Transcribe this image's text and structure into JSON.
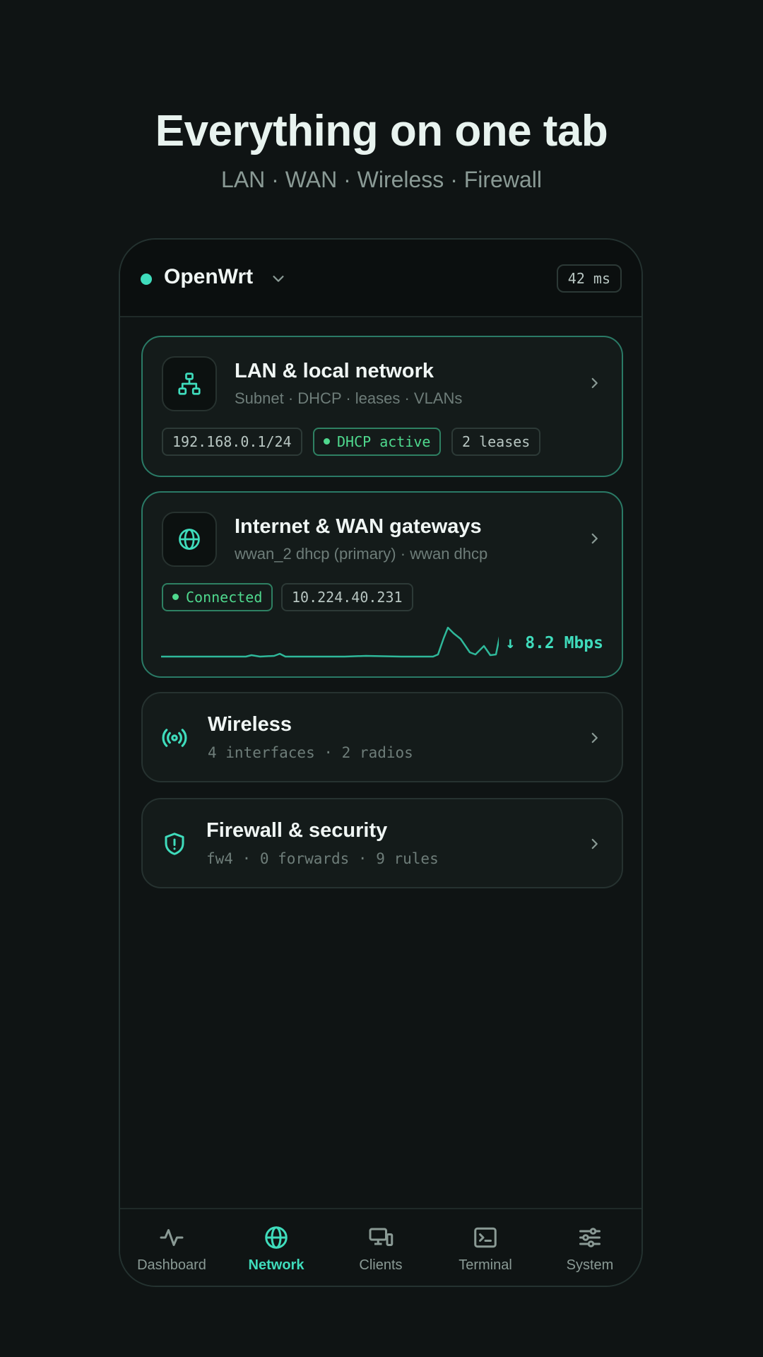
{
  "hero": {
    "title": "Everything on one tab",
    "subtitle": "LAN · WAN · Wireless · Firewall"
  },
  "topbar": {
    "router_name": "OpenWrt",
    "status_color": "#3fdcbc",
    "latency": "42 ms"
  },
  "cards": {
    "lan": {
      "title": "LAN & local network",
      "subtitle": "Subnet · DHCP · leases · VLANs",
      "icon": "network-topology-icon",
      "chips": [
        "192.168.0.1/24",
        "DHCP active",
        "2 leases"
      ]
    },
    "wan": {
      "title": "Internet & WAN gateways",
      "subtitle": "wwan_2 dhcp (primary) · wwan dhcp",
      "icon": "globe-icon",
      "chips": [
        "Connected",
        "10.224.40.231"
      ],
      "speed": "↓ 8.2 Mbps"
    },
    "wireless": {
      "title": "Wireless",
      "subtitle": "4 interfaces · 2 radios",
      "icon": "wireless-broadcast-icon"
    },
    "firewall": {
      "title": "Firewall & security",
      "subtitle": "fw4 · 0 forwards · 9 rules",
      "icon": "shield-alert-icon"
    }
  },
  "nav": {
    "items": [
      {
        "label": "Dashboard",
        "icon": "activity-icon"
      },
      {
        "label": "Network",
        "icon": "globe-icon",
        "active": true
      },
      {
        "label": "Clients",
        "icon": "devices-icon"
      },
      {
        "label": "Terminal",
        "icon": "terminal-icon"
      },
      {
        "label": "System",
        "icon": "sliders-icon"
      }
    ]
  },
  "colors": {
    "accent": "#3fdcbc",
    "success": "#4fd98e",
    "background": "#0f1414"
  }
}
